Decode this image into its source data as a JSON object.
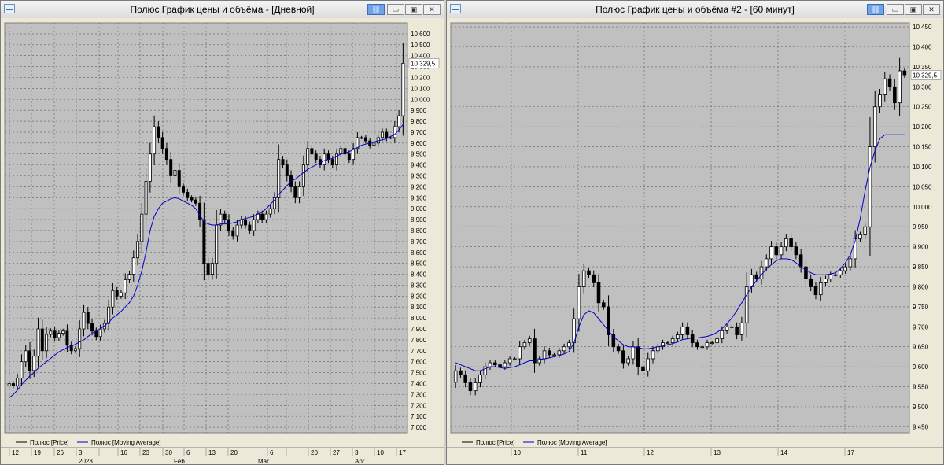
{
  "windows": [
    {
      "title": "Полюс График цены и объёма - [Дневной]",
      "y_ticks": [
        "10 600",
        "10 500",
        "10 400",
        "10 300",
        "10 200",
        "10 100",
        "10 000",
        "9 900",
        "9 800",
        "9 700",
        "9 600",
        "9 500",
        "9 400",
        "9 300",
        "9 200",
        "9 100",
        "9 000",
        "8 900",
        "8 800",
        "8 700",
        "8 600",
        "8 500",
        "8 400",
        "8 300",
        "8 200",
        "8 100",
        "8 000",
        "7 900",
        "7 800",
        "7 700",
        "7 600",
        "7 500",
        "7 400",
        "7 300",
        "7 200",
        "7 100",
        "7 000"
      ],
      "last_price": "10 329,5",
      "x_ticks": [
        "12",
        "19",
        "26",
        "3",
        "",
        "16",
        "23",
        "30",
        "6",
        "13",
        "20",
        "6",
        "",
        "20",
        "27",
        "3",
        "10",
        "17"
      ],
      "x_periods": [
        "2023",
        "Feb",
        "Mar",
        "Apr"
      ],
      "legend": {
        "price": "Полюс [Price]",
        "ma": "Полюс [Moving Average]"
      }
    },
    {
      "title": "Полюс График цены и объёма #2 - [60 минут]",
      "y_ticks": [
        "10 450",
        "10 400",
        "10 350",
        "10 300",
        "10 250",
        "10 200",
        "10 150",
        "10 100",
        "10 050",
        "10 000",
        "9 950",
        "9 900",
        "9 850",
        "9 800",
        "9 750",
        "9 700",
        "9 650",
        "9 600",
        "9 550",
        "9 500",
        "9 450"
      ],
      "last_price": "10 329,5",
      "x_ticks": [
        "10",
        "11",
        "12",
        "13",
        "14",
        "17"
      ],
      "legend": {
        "price": "Полюс [Price]",
        "ma": "Полюс [Moving Average]"
      }
    }
  ],
  "colors": {
    "plot_bg": "#c0c0c0",
    "grid": "#606060",
    "ma_line": "#0000cc",
    "candle": "#000000"
  },
  "chart_data": [
    {
      "type": "candlestick",
      "title": "Полюс График цены и объёма - [Дневной]",
      "ylim": [
        6950,
        10700
      ],
      "series": [
        {
          "name": "Полюс [Price]",
          "close": [
            7400,
            7380,
            7450,
            7600,
            7700,
            7520,
            7650,
            7900,
            7700,
            7850,
            7880,
            7820,
            7860,
            7880,
            7750,
            7700,
            7720,
            7900,
            8050,
            7950,
            7880,
            7830,
            7900,
            7950,
            8100,
            8250,
            8200,
            8230,
            8350,
            8400,
            8550,
            8700,
            8950,
            9250,
            9500,
            9750,
            9650,
            9550,
            9450,
            9300,
            9350,
            9200,
            9150,
            9100,
            9080,
            9050,
            8900,
            8500,
            8400,
            8500,
            8850,
            8950,
            8900,
            8800,
            8750,
            8850,
            8900,
            8850,
            8800,
            8900,
            8950,
            8900,
            8950,
            9000,
            9100,
            9450,
            9400,
            9300,
            9200,
            9100,
            9200,
            9400,
            9550,
            9500,
            9450,
            9400,
            9500,
            9450,
            9400,
            9500,
            9550,
            9500,
            9450,
            9550,
            9650,
            9650,
            9620,
            9580,
            9600,
            9650,
            9700,
            9650,
            9650,
            9750,
            9850,
            10330
          ]
        },
        {
          "name": "Полюс [Moving Average]",
          "values": [
            7270,
            7300,
            7340,
            7390,
            7430,
            7470,
            7500,
            7540,
            7570,
            7600,
            7630,
            7660,
            7690,
            7710,
            7730,
            7740,
            7760,
            7780,
            7800,
            7830,
            7860,
            7880,
            7900,
            7930,
            7960,
            8000,
            8030,
            8060,
            8100,
            8140,
            8200,
            8300,
            8430,
            8600,
            8800,
            8930,
            9000,
            9050,
            9070,
            9090,
            9100,
            9090,
            9070,
            9050,
            9030,
            9000,
            8940,
            8880,
            8860,
            8850,
            8850,
            8860,
            8860,
            8860,
            8870,
            8880,
            8900,
            8910,
            8920,
            8930,
            8950,
            8970,
            9000,
            9040,
            9080,
            9130,
            9170,
            9210,
            9250,
            9270,
            9300,
            9330,
            9360,
            9380,
            9400,
            9420,
            9440,
            9450,
            9460,
            9480,
            9500,
            9510,
            9520,
            9540,
            9560,
            9580,
            9590,
            9600,
            9610,
            9620,
            9630,
            9640,
            9660,
            9680,
            9720,
            9770
          ]
        }
      ]
    },
    {
      "type": "candlestick",
      "title": "Полюс График цены и объёма #2 - [60 минут]",
      "ylim": [
        9435,
        10460
      ],
      "series": [
        {
          "name": "Полюс [Price]",
          "close": [
            9590,
            9580,
            9560,
            9540,
            9560,
            9580,
            9600,
            9610,
            9605,
            9600,
            9610,
            9620,
            9620,
            9650,
            9660,
            9670,
            9610,
            9620,
            9640,
            9630,
            9630,
            9640,
            9650,
            9660,
            9720,
            9800,
            9840,
            9830,
            9810,
            9760,
            9750,
            9680,
            9650,
            9640,
            9610,
            9620,
            9650,
            9600,
            9590,
            9620,
            9640,
            9650,
            9660,
            9660,
            9670,
            9680,
            9700,
            9680,
            9660,
            9650,
            9650,
            9660,
            9660,
            9670,
            9690,
            9700,
            9700,
            9680,
            9710,
            9800,
            9830,
            9820,
            9850,
            9870,
            9900,
            9880,
            9900,
            9920,
            9900,
            9880,
            9850,
            9820,
            9800,
            9780,
            9810,
            9820,
            9830,
            9830,
            9840,
            9850,
            9870,
            9920,
            9930,
            9950,
            10150,
            10250,
            10280,
            10320,
            10300,
            10260,
            10340,
            10330
          ]
        },
        {
          "name": "Полюс [Moving Average]",
          "values": [
            9610,
            9605,
            9600,
            9595,
            9590,
            9590,
            9595,
            9600,
            9600,
            9598,
            9596,
            9598,
            9600,
            9605,
            9610,
            9615,
            9615,
            9618,
            9620,
            9622,
            9625,
            9628,
            9632,
            9638,
            9660,
            9700,
            9730,
            9740,
            9735,
            9720,
            9705,
            9690,
            9675,
            9665,
            9655,
            9650,
            9650,
            9648,
            9645,
            9645,
            9647,
            9650,
            9652,
            9655,
            9658,
            9662,
            9668,
            9670,
            9672,
            9672,
            9674,
            9676,
            9680,
            9686,
            9695,
            9708,
            9722,
            9740,
            9760,
            9780,
            9800,
            9815,
            9830,
            9845,
            9855,
            9865,
            9870,
            9870,
            9868,
            9860,
            9850,
            9842,
            9835,
            9830,
            9830,
            9830,
            9832,
            9835,
            9845,
            9860,
            9880,
            9915,
            9970,
            10040,
            10100,
            10140,
            10170,
            10180,
            10180,
            10180,
            10180,
            10180
          ]
        }
      ]
    }
  ]
}
